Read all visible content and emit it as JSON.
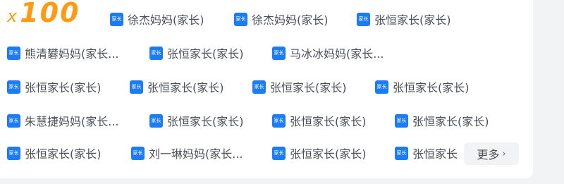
{
  "reward": {
    "multiplier_symbol": "x",
    "count": "100"
  },
  "supporters": [
    {
      "badge": "家长",
      "name": "徐杰妈妈(家长)"
    },
    {
      "badge": "家长",
      "name": "徐杰妈妈(家长)"
    },
    {
      "badge": "家长",
      "name": "张恒家长(家长)"
    },
    {
      "badge": "家长",
      "name": "熊清礬妈妈(家长..."
    },
    {
      "badge": "家长",
      "name": "张恒家长(家长)"
    },
    {
      "badge": "家长",
      "name": "马冰冰妈妈(家长..."
    },
    {
      "badge": "家长",
      "name": "张恒家长(家长)"
    },
    {
      "badge": "家长",
      "name": "张恒家长(家长)"
    },
    {
      "badge": "家长",
      "name": "张恒家长(家长)"
    },
    {
      "badge": "家长",
      "name": "张恒家长(家长)"
    },
    {
      "badge": "家长",
      "name": "朱慧捷妈妈(家长..."
    },
    {
      "badge": "家长",
      "name": "张恒家长(家长)"
    },
    {
      "badge": "家长",
      "name": "张恒家长(家长)"
    },
    {
      "badge": "家长",
      "name": "张恒家长(家长)"
    },
    {
      "badge": "家长",
      "name": "张恒家长(家长)"
    },
    {
      "badge": "家长",
      "name": "刘一琳妈妈(家长..."
    },
    {
      "badge": "家长",
      "name": "张恒家长(家长)"
    },
    {
      "badge": "家长",
      "name": "张恒家长"
    }
  ],
  "more_button": {
    "label": "更多",
    "icon": "chevron-right-icon"
  },
  "colors": {
    "count": "#ff9a12",
    "badge": "#1c7cf5",
    "text": "#4a4f57"
  }
}
